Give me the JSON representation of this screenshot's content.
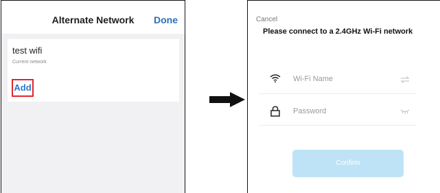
{
  "left_screen": {
    "title": "Alternate Network",
    "done_label": "Done",
    "network": {
      "name": "test wifi",
      "subtitle": "Current network"
    },
    "add_label": "Add"
  },
  "right_screen": {
    "cancel_label": "Cancel",
    "heading": "Please connect to a 2.4GHz Wi-Fi network",
    "wifi_field": {
      "placeholder": "Wi-Fi Name"
    },
    "password_field": {
      "placeholder": "Password"
    },
    "confirm_label": "Confirm"
  },
  "colors": {
    "done": "#2b6fb6",
    "add_text": "#2b78c8",
    "add_highlight": "#e0242b",
    "confirm_bg": "#bfe3f6"
  },
  "icons": {
    "wifi_field": "wifi-icon",
    "password_field": "lock-icon",
    "wifi_field_end": "swap-arrows-icon",
    "password_field_end": "eye-closed-icon",
    "flow": "right-arrow-icon"
  }
}
